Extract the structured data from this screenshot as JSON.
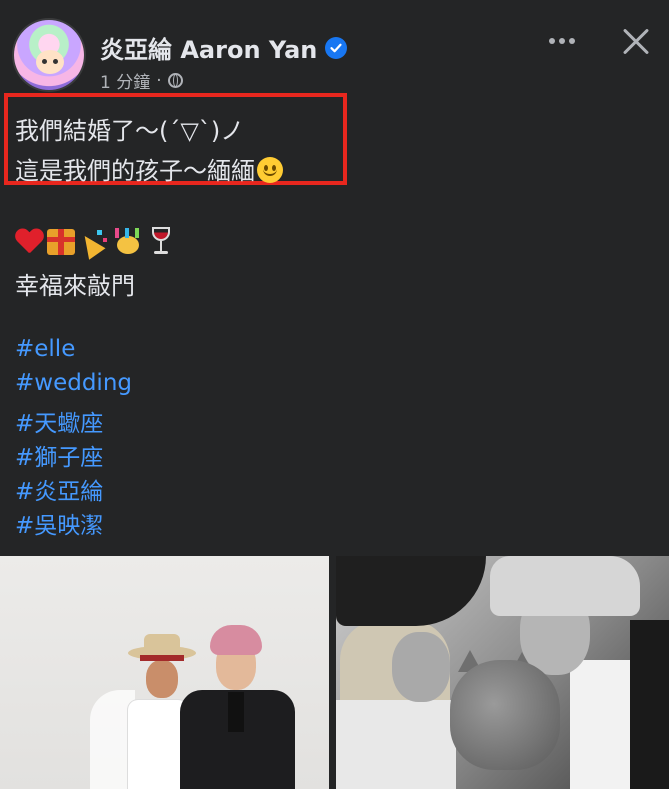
{
  "post": {
    "author": "炎亞綸 Aaron Yan",
    "time": "1 分鐘",
    "separator": "·",
    "text_line_1": "我們結婚了～(ˊ▽ˋ)ノ",
    "text_line_2": "這是我們的孩子～緬緬",
    "line_3": "幸福來敲門",
    "hashtags": [
      "#elle",
      "#wedding",
      "#天蠍座",
      "#獅子座",
      "#炎亞綸",
      "#吳映潔"
    ]
  },
  "icons": {
    "verified": "verified-badge-icon",
    "privacy": "globe-icon",
    "more": "more-options-icon",
    "close": "close-icon",
    "emoji": [
      "red-heart",
      "wrapped-gift",
      "party-popper",
      "confetti-ball",
      "wine-glass"
    ],
    "smiley": "slightly-smiling-face"
  },
  "colors": {
    "background": "#242526",
    "hashtag": "#4599ff",
    "highlight_border": "#e8271e",
    "verified": "#1877f2"
  }
}
